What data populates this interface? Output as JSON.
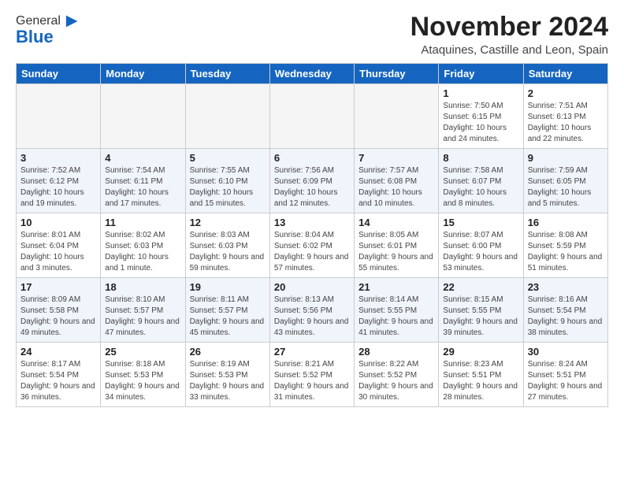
{
  "logo": {
    "general": "General",
    "blue": "Blue"
  },
  "header": {
    "month": "November 2024",
    "location": "Ataquines, Castille and Leon, Spain"
  },
  "weekdays": [
    "Sunday",
    "Monday",
    "Tuesday",
    "Wednesday",
    "Thursday",
    "Friday",
    "Saturday"
  ],
  "weeks": [
    [
      {
        "day": "",
        "info": ""
      },
      {
        "day": "",
        "info": ""
      },
      {
        "day": "",
        "info": ""
      },
      {
        "day": "",
        "info": ""
      },
      {
        "day": "",
        "info": ""
      },
      {
        "day": "1",
        "info": "Sunrise: 7:50 AM\nSunset: 6:15 PM\nDaylight: 10 hours and 24 minutes."
      },
      {
        "day": "2",
        "info": "Sunrise: 7:51 AM\nSunset: 6:13 PM\nDaylight: 10 hours and 22 minutes."
      }
    ],
    [
      {
        "day": "3",
        "info": "Sunrise: 7:52 AM\nSunset: 6:12 PM\nDaylight: 10 hours and 19 minutes."
      },
      {
        "day": "4",
        "info": "Sunrise: 7:54 AM\nSunset: 6:11 PM\nDaylight: 10 hours and 17 minutes."
      },
      {
        "day": "5",
        "info": "Sunrise: 7:55 AM\nSunset: 6:10 PM\nDaylight: 10 hours and 15 minutes."
      },
      {
        "day": "6",
        "info": "Sunrise: 7:56 AM\nSunset: 6:09 PM\nDaylight: 10 hours and 12 minutes."
      },
      {
        "day": "7",
        "info": "Sunrise: 7:57 AM\nSunset: 6:08 PM\nDaylight: 10 hours and 10 minutes."
      },
      {
        "day": "8",
        "info": "Sunrise: 7:58 AM\nSunset: 6:07 PM\nDaylight: 10 hours and 8 minutes."
      },
      {
        "day": "9",
        "info": "Sunrise: 7:59 AM\nSunset: 6:05 PM\nDaylight: 10 hours and 5 minutes."
      }
    ],
    [
      {
        "day": "10",
        "info": "Sunrise: 8:01 AM\nSunset: 6:04 PM\nDaylight: 10 hours and 3 minutes."
      },
      {
        "day": "11",
        "info": "Sunrise: 8:02 AM\nSunset: 6:03 PM\nDaylight: 10 hours and 1 minute."
      },
      {
        "day": "12",
        "info": "Sunrise: 8:03 AM\nSunset: 6:03 PM\nDaylight: 9 hours and 59 minutes."
      },
      {
        "day": "13",
        "info": "Sunrise: 8:04 AM\nSunset: 6:02 PM\nDaylight: 9 hours and 57 minutes."
      },
      {
        "day": "14",
        "info": "Sunrise: 8:05 AM\nSunset: 6:01 PM\nDaylight: 9 hours and 55 minutes."
      },
      {
        "day": "15",
        "info": "Sunrise: 8:07 AM\nSunset: 6:00 PM\nDaylight: 9 hours and 53 minutes."
      },
      {
        "day": "16",
        "info": "Sunrise: 8:08 AM\nSunset: 5:59 PM\nDaylight: 9 hours and 51 minutes."
      }
    ],
    [
      {
        "day": "17",
        "info": "Sunrise: 8:09 AM\nSunset: 5:58 PM\nDaylight: 9 hours and 49 minutes."
      },
      {
        "day": "18",
        "info": "Sunrise: 8:10 AM\nSunset: 5:57 PM\nDaylight: 9 hours and 47 minutes."
      },
      {
        "day": "19",
        "info": "Sunrise: 8:11 AM\nSunset: 5:57 PM\nDaylight: 9 hours and 45 minutes."
      },
      {
        "day": "20",
        "info": "Sunrise: 8:13 AM\nSunset: 5:56 PM\nDaylight: 9 hours and 43 minutes."
      },
      {
        "day": "21",
        "info": "Sunrise: 8:14 AM\nSunset: 5:55 PM\nDaylight: 9 hours and 41 minutes."
      },
      {
        "day": "22",
        "info": "Sunrise: 8:15 AM\nSunset: 5:55 PM\nDaylight: 9 hours and 39 minutes."
      },
      {
        "day": "23",
        "info": "Sunrise: 8:16 AM\nSunset: 5:54 PM\nDaylight: 9 hours and 38 minutes."
      }
    ],
    [
      {
        "day": "24",
        "info": "Sunrise: 8:17 AM\nSunset: 5:54 PM\nDaylight: 9 hours and 36 minutes."
      },
      {
        "day": "25",
        "info": "Sunrise: 8:18 AM\nSunset: 5:53 PM\nDaylight: 9 hours and 34 minutes."
      },
      {
        "day": "26",
        "info": "Sunrise: 8:19 AM\nSunset: 5:53 PM\nDaylight: 9 hours and 33 minutes."
      },
      {
        "day": "27",
        "info": "Sunrise: 8:21 AM\nSunset: 5:52 PM\nDaylight: 9 hours and 31 minutes."
      },
      {
        "day": "28",
        "info": "Sunrise: 8:22 AM\nSunset: 5:52 PM\nDaylight: 9 hours and 30 minutes."
      },
      {
        "day": "29",
        "info": "Sunrise: 8:23 AM\nSunset: 5:51 PM\nDaylight: 9 hours and 28 minutes."
      },
      {
        "day": "30",
        "info": "Sunrise: 8:24 AM\nSunset: 5:51 PM\nDaylight: 9 hours and 27 minutes."
      }
    ]
  ]
}
